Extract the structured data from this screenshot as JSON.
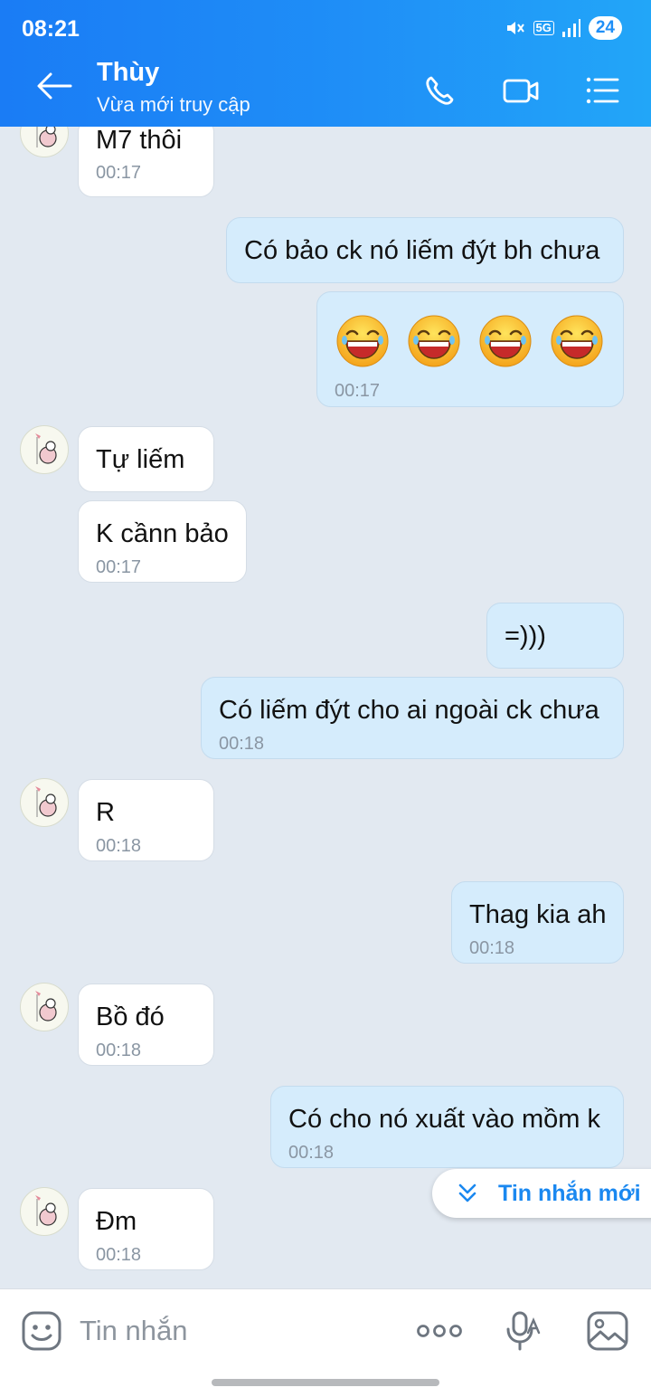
{
  "status_bar": {
    "time": "08:21",
    "network": "5G",
    "battery": "24"
  },
  "header": {
    "title": "Thùy",
    "subtitle": "Vừa mới truy cập"
  },
  "messages": [
    {
      "dir": "in",
      "text": "M7 thôi",
      "time": "00:17"
    },
    {
      "dir": "out",
      "text": "Có bảo ck nó liếm đýt bh chưa"
    },
    {
      "dir": "out",
      "emoji": [
        "laughing-face",
        "laughing-face",
        "laughing-face",
        "laughing-face"
      ],
      "time": "00:17"
    },
    {
      "dir": "in",
      "text": "Tự liếm"
    },
    {
      "dir": "in",
      "text": "K cầnn bảo",
      "time": "00:17"
    },
    {
      "dir": "out",
      "text": "=)))"
    },
    {
      "dir": "out",
      "text": "Có liếm đýt cho ai ngoài ck chưa",
      "time": "00:18"
    },
    {
      "dir": "in",
      "text": "R",
      "time": "00:18"
    },
    {
      "dir": "out",
      "text": "Thag kia ah",
      "time": "00:18"
    },
    {
      "dir": "in",
      "text": "Bồ đó",
      "time": "00:18"
    },
    {
      "dir": "out",
      "text": "Có cho nó xuất vào mồm k",
      "time": "00:18"
    },
    {
      "dir": "in",
      "text": "Đm",
      "time": "00:18"
    }
  ],
  "new_message_pill": {
    "label": "Tin nhắn mới"
  },
  "input": {
    "placeholder": "Tin nhắn"
  }
}
